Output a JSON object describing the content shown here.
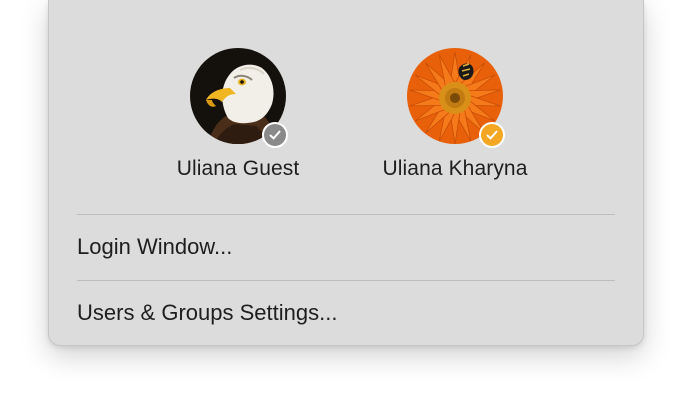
{
  "users": [
    {
      "name": "Uliana Guest",
      "avatar": "eagle-avatar",
      "status_icon": "checkmark-icon",
      "status_color": "#8a8a8a"
    },
    {
      "name": "Uliana Kharyna",
      "avatar": "orange-flower-avatar",
      "status_icon": "checkmark-icon",
      "status_color": "#f5a623"
    }
  ],
  "menu_items": [
    {
      "label": "Login Window..."
    },
    {
      "label": "Users & Groups Settings..."
    }
  ]
}
